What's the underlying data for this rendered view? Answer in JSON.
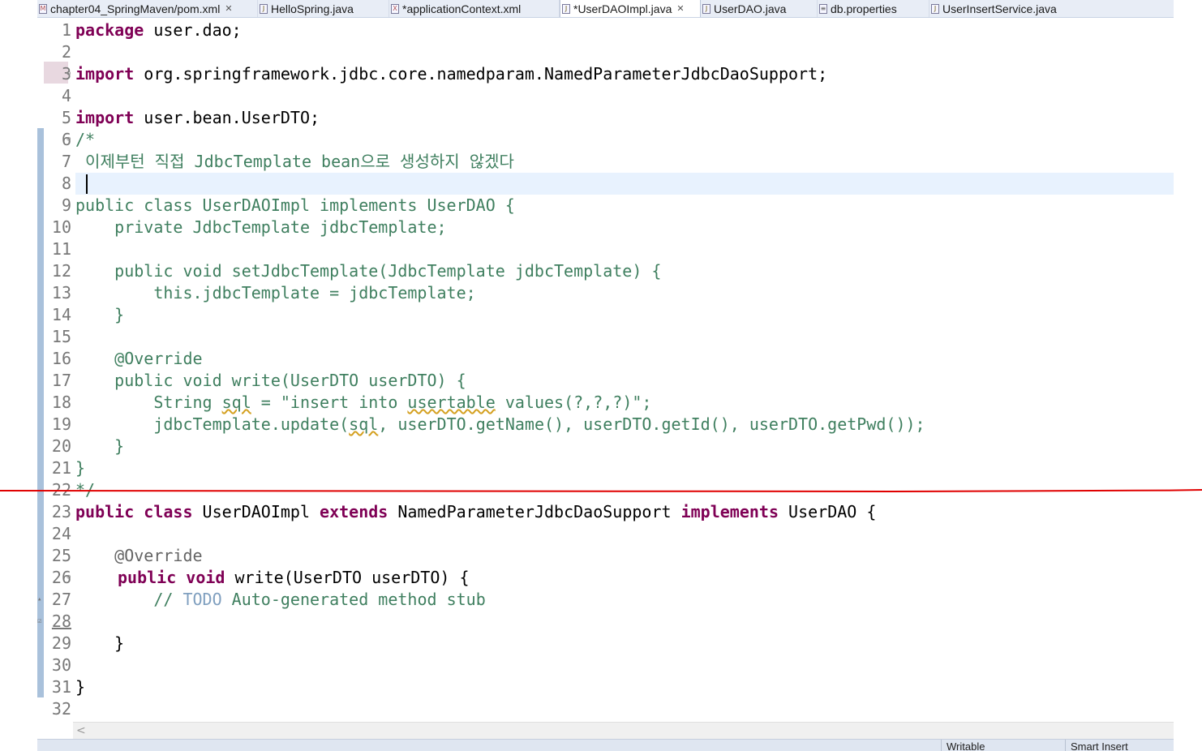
{
  "tabs": [
    {
      "label": "chapter04_SpringMaven/pom.xml",
      "icon": "xml-file-icon",
      "closable": true
    },
    {
      "label": "HelloSpring.java",
      "icon": "java-file-icon"
    },
    {
      "label": "*applicationContext.xml",
      "icon": "xml-file-icon"
    },
    {
      "label": "*UserDAOImpl.java",
      "icon": "java-file-icon",
      "active": true,
      "closable": true
    },
    {
      "label": "UserDAO.java",
      "icon": "java-file-icon"
    },
    {
      "label": "db.properties",
      "icon": "properties-file-icon"
    },
    {
      "label": "UserInsertService.java",
      "icon": "java-file-icon"
    }
  ],
  "line_numbers": [
    "1",
    "2",
    "3",
    "4",
    "5",
    "6",
    "7",
    "8",
    "9",
    "10",
    "11",
    "12",
    "13",
    "14",
    "15",
    "16",
    "17",
    "18",
    "19",
    "20",
    "21",
    "22",
    "23",
    "24",
    "25",
    "26",
    "27",
    "28",
    "29",
    "30",
    "31",
    "32"
  ],
  "code": {
    "l1_kw": "package",
    "l1_rest": " user.dao;",
    "l3_kw": "import",
    "l3_rest": " org.springframework.jdbc.core.namedparam.NamedParameterJdbcDaoSupport;",
    "l5_kw": "import",
    "l5_rest": " user.bean.UserDTO;",
    "l6": "/*",
    "l7": " 이제부턴 직접 JdbcTemplate bean으로 생성하지 않겠다",
    "l9": "public class UserDAOImpl implements UserDAO {",
    "l10": "    private JdbcTemplate jdbcTemplate;",
    "l12": "    public void setJdbcTemplate(JdbcTemplate jdbcTemplate) {",
    "l13": "        this.jdbcTemplate = jdbcTemplate;",
    "l14": "    }",
    "l16": "    @Override",
    "l17": "    public void write(UserDTO userDTO) {",
    "l18_a": "        String ",
    "l18_b": "sql",
    "l18_c": " = \"insert into ",
    "l18_d": "usertable",
    "l18_e": " values(?,?,?)\";",
    "l19_a": "        jdbcTemplate.update(",
    "l19_b": "sql",
    "l19_c": ", userDTO.getName(), userDTO.getId(), userDTO.getPwd());",
    "l20": "    }",
    "l21": "}",
    "l22": "*/",
    "l23_a": "public class",
    "l23_b": " UserDAOImpl ",
    "l23_c": "extends",
    "l23_d": " NamedParameterJdbcDaoSupport ",
    "l23_e": "implements",
    "l23_f": " UserDAO {",
    "l25": "    @Override",
    "l26_a": "public void",
    "l26_b": " write(UserDTO userDTO) {",
    "l27_a": "        // ",
    "l27_b": "TODO",
    "l27_c": " Auto-generated method stub",
    "l29": "    }",
    "l31": "}"
  },
  "scroll_arrow": "<",
  "status": {
    "writable": "Writable",
    "insert_mode": "Smart Insert"
  },
  "colors": {
    "keyword": "#7f0055",
    "comment": "#3f7f5f",
    "todo": "#7f9fbf",
    "current_line": "#e8f2fe",
    "annotation_line": "#e00000"
  }
}
